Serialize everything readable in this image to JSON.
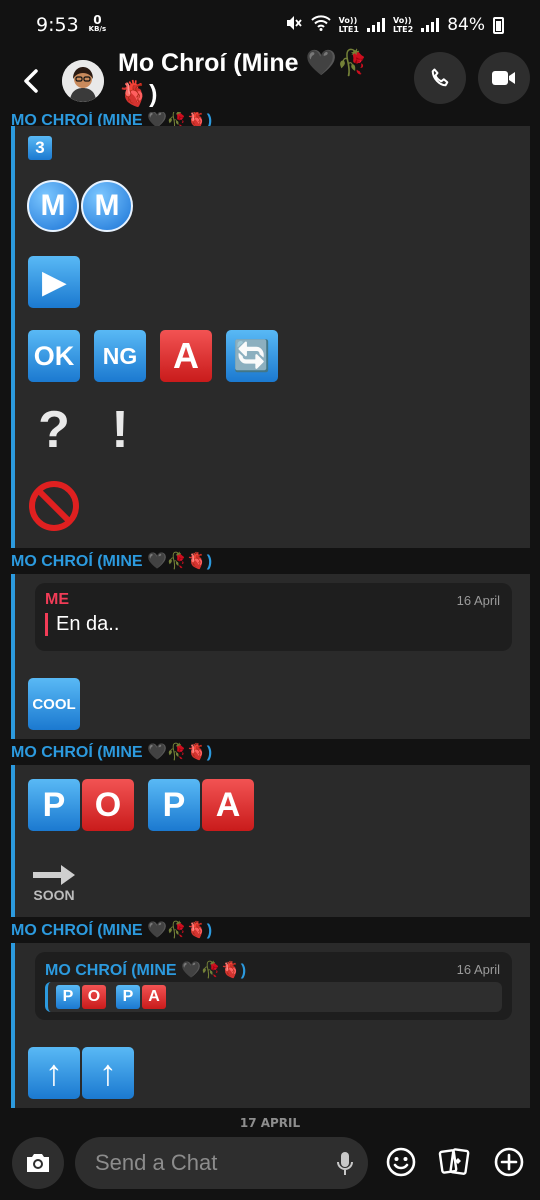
{
  "status_bar": {
    "time": "9:53",
    "net_speed": "0",
    "net_unit": "KB/s",
    "lte1": "LTE1",
    "lte2": "LTE2",
    "vo1": "Vo))",
    "vo2": "Vo))",
    "battery": "84%"
  },
  "header": {
    "title": "Mo Chroí (Mine 🖤🥀🫀)",
    "back_icon": "chevron-left-icon",
    "call_icon": "phone-icon",
    "video_icon": "video-icon"
  },
  "chat": {
    "top_sender_cut": "MO CHROÍ (MINE 🖤🥀🫀)",
    "messages": [
      {
        "sender": "MO CHROÍ (MINE 🖤🥀🫀)",
        "emojis": [
          "3",
          "M",
          "M",
          "▶",
          "OK",
          "NG",
          "A",
          "🔄",
          "?",
          "!",
          "🚫"
        ]
      },
      {
        "sender": "MO CHROÍ (MINE 🖤🥀🫀)",
        "quote": {
          "name": "ME",
          "date": "16 April",
          "text": "En da.."
        },
        "emojis": [
          "COOL"
        ]
      },
      {
        "sender": "MO CHROÍ (MINE 🖤🥀🫀)",
        "emojis": [
          "P",
          "O",
          "P",
          "A",
          "SOON"
        ]
      },
      {
        "sender": "MO CHROÍ (MINE 🖤🥀🫀)",
        "quote": {
          "name": "MO CHROÍ (MINE 🖤🥀🫀)",
          "date": "16 April",
          "letters": [
            "P",
            "O",
            "P",
            "A"
          ]
        },
        "emojis": [
          "↑",
          "↑"
        ]
      }
    ],
    "date_divider": "17 APRIL"
  },
  "composer": {
    "placeholder": "Send a Chat",
    "camera_icon": "camera-icon",
    "mic_icon": "mic-icon",
    "emoji_icon": "smiley-icon",
    "cards_icon": "cards-icon",
    "plus_icon": "plus-icon"
  },
  "colors": {
    "background": "#121212",
    "bubble": "#2a2a2a",
    "accent_blue": "#2c9ade",
    "me_red": "#f23c57"
  }
}
